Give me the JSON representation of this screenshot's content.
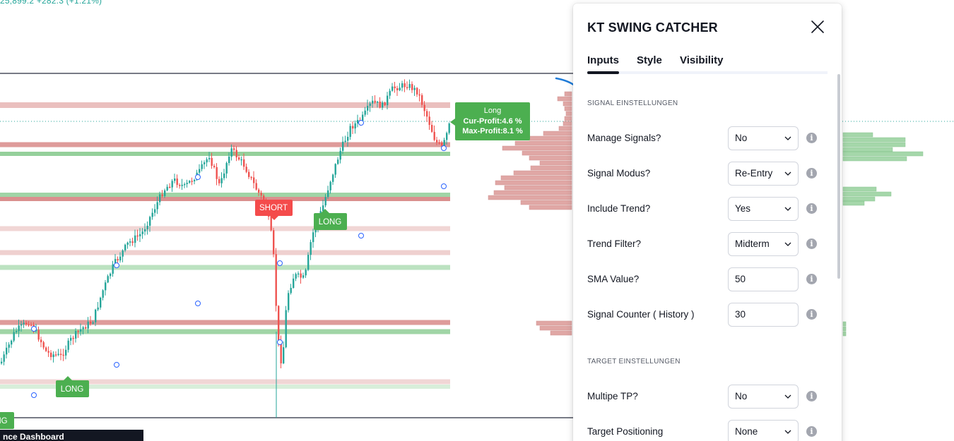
{
  "ticker": {
    "text": "25,899.2 +282.3 (+1.21%)"
  },
  "chart_labels": {
    "short": "SHORT",
    "long_mid": "LONG",
    "long_low": "LONG",
    "long_edge": "NG",
    "box_line1": "Long",
    "box_line2": "Cur-Profit:4.6 %",
    "box_line3": "Max-Profit:8.1 %"
  },
  "bottom_tab": {
    "label": "nce Dashboard"
  },
  "colors": {
    "up": "#26a69a",
    "down": "#ef5350",
    "long_label": "#4caf50",
    "short_label": "#f44b4b",
    "red_zone": "#d88a88",
    "green_zone": "#8fce96",
    "arrow": "#1e7bd8"
  },
  "dialog": {
    "title": "KT SWING CATCHER",
    "close_icon": "close-icon",
    "tabs": [
      {
        "label": "Inputs",
        "active": true
      },
      {
        "label": "Style",
        "active": false
      },
      {
        "label": "Visibility",
        "active": false
      }
    ],
    "sections": [
      {
        "label": "SIGNAL EINSTELLUNGEN"
      },
      {
        "label": "TARGET EINSTELLUNGEN"
      }
    ],
    "rows": [
      {
        "label": "Manage Signals?",
        "value": "No",
        "type": "select"
      },
      {
        "label": "Signal Modus?",
        "value": "Re-Entry",
        "type": "select"
      },
      {
        "label": "Include Trend?",
        "value": "Yes",
        "type": "select"
      },
      {
        "label": "Trend Filter?",
        "value": "Midterm",
        "type": "select"
      },
      {
        "label": "SMA Value?",
        "value": "50",
        "type": "input"
      },
      {
        "label": "Signal Counter ( History )",
        "value": "30",
        "type": "input"
      },
      {
        "label": "Multipe TP?",
        "value": "No",
        "type": "select"
      },
      {
        "label": "Target Positioning",
        "value": "None",
        "type": "select"
      }
    ]
  }
}
